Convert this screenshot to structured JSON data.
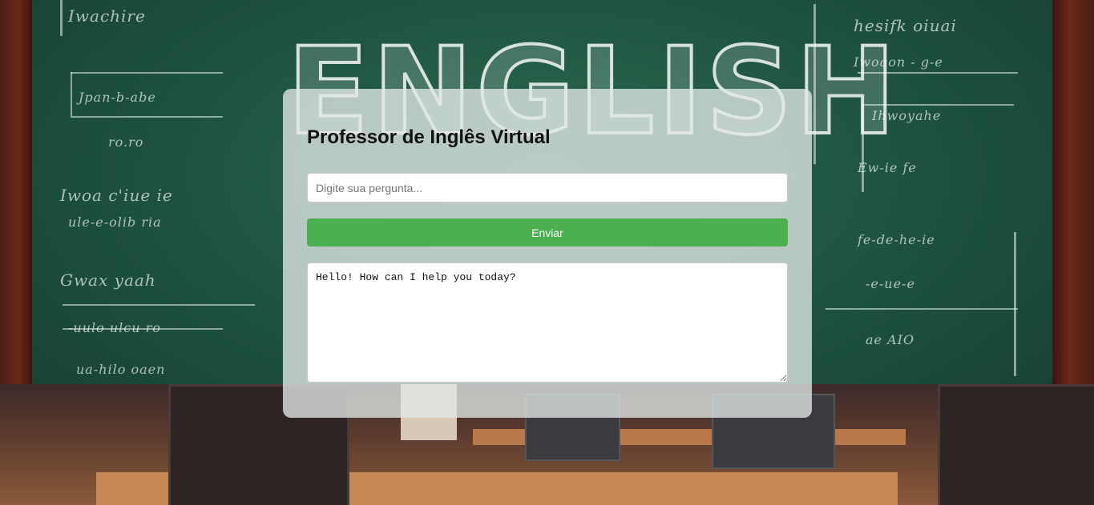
{
  "app": {
    "title": "Professor de Inglês Virtual"
  },
  "background": {
    "board_word": "ENGLISH"
  },
  "form": {
    "question_placeholder": "Digite sua pergunta...",
    "question_value": "",
    "send_label": "Enviar",
    "response_text": "Hello! How can I help you today?"
  },
  "colors": {
    "accent": "#4caf50",
    "board": "#1f5541"
  }
}
